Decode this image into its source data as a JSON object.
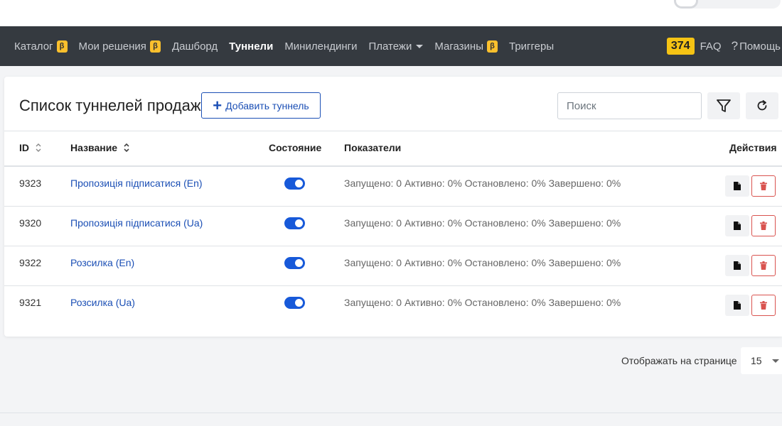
{
  "nav": {
    "items": [
      {
        "label": "Каталог",
        "beta": "β",
        "active": false
      },
      {
        "label": "Мои решения",
        "beta": "β",
        "active": false
      },
      {
        "label": "Дашборд",
        "beta": null,
        "active": false
      },
      {
        "label": "Туннели",
        "beta": null,
        "active": true
      },
      {
        "label": "Минилендинги",
        "beta": null,
        "active": false
      },
      {
        "label": "Платежи",
        "beta": null,
        "active": false,
        "dropdown": true
      },
      {
        "label": "Магазины",
        "beta": "β",
        "active": false
      },
      {
        "label": "Триггеры",
        "beta": null,
        "active": false
      }
    ],
    "count_badge": "374",
    "faq": "FAQ",
    "help_q": "?",
    "help": "Помощь"
  },
  "page": {
    "title": "Список туннелей продаж",
    "add_button": "Добавить туннель",
    "add_icon": "+",
    "search_placeholder": "Поиск"
  },
  "table": {
    "headers": {
      "id": "ID",
      "name": "Название",
      "state": "Состояние",
      "stats": "Показатели",
      "actions": "Действия"
    },
    "rows": [
      {
        "id": "9323",
        "name": "Пропозиція підписатися (En)",
        "enabled": true,
        "stats": "Запущено: 0 Активно: 0% Остановлено: 0% Завершено: 0%"
      },
      {
        "id": "9320",
        "name": "Пропозиція підписатися (Ua)",
        "enabled": true,
        "stats": "Запущено: 0 Активно: 0% Остановлено: 0% Завершено: 0%"
      },
      {
        "id": "9322",
        "name": "Розсилка (En)",
        "enabled": true,
        "stats": "Запущено: 0 Активно: 0% Остановлено: 0% Завершено: 0%"
      },
      {
        "id": "9321",
        "name": "Розсилка (Ua)",
        "enabled": true,
        "stats": "Запущено: 0 Активно: 0% Остановлено: 0% Завершено: 0%"
      }
    ]
  },
  "pagination": {
    "per_page_label": "Отображать на странице",
    "per_page_value": "15"
  },
  "colors": {
    "navbar": "#353a40",
    "accent": "#1b4fb5",
    "toggle_on": "#1759d9",
    "beta_badge": "#fbc02d",
    "delete": "#d9534f"
  },
  "icons": {
    "filter": "filter-icon",
    "refresh": "refresh-icon",
    "document": "document-icon",
    "delete": "trash-icon",
    "sort": "sort-icon"
  }
}
